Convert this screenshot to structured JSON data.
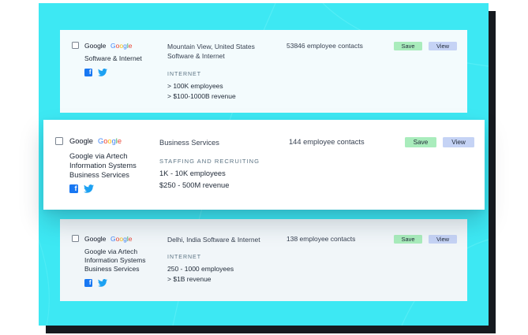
{
  "colors": {
    "frame_bg": "#3de8f3",
    "save_bg": "#a9ecbc",
    "view_bg": "#c5d3f5",
    "facebook": "#1877f2",
    "twitter": "#1da1f2"
  },
  "cards": [
    {
      "company": "Google",
      "logo_text": "Google",
      "subtitle": "Software & Internet",
      "location": "Mountain View, United States Software & Internet",
      "industry": "INTERNET",
      "size_lines": [
        "> 100K employees",
        "> $100-1000B revenue"
      ],
      "contacts": "53846 employee contacts",
      "save_label": "Save",
      "view_label": "View",
      "social_icons": [
        "facebook-icon",
        "twitter-icon"
      ]
    },
    {
      "company": "Google",
      "logo_text": "Google",
      "subtitle": "Google via Artech Information Systems Business Services",
      "location": "Business Services",
      "industry": "STAFFING AND RECRUITING",
      "size_lines": [
        "1K - 10K employees",
        "$250 - 500M revenue"
      ],
      "contacts": "144 employee contacts",
      "save_label": "Save",
      "view_label": "View",
      "social_icons": [
        "facebook-icon",
        "twitter-icon"
      ]
    },
    {
      "company": "Google",
      "logo_text": "Google",
      "subtitle": "Google via Artech Information Systems Business Services",
      "location": "Delhi, India Software & Internet",
      "industry": "INTERNET",
      "size_lines": [
        "250 - 1000 employees",
        "> $1B revenue"
      ],
      "contacts": "138 employee contacts",
      "save_label": "Save",
      "view_label": "View",
      "social_icons": [
        "facebook-icon",
        "twitter-icon"
      ]
    }
  ]
}
